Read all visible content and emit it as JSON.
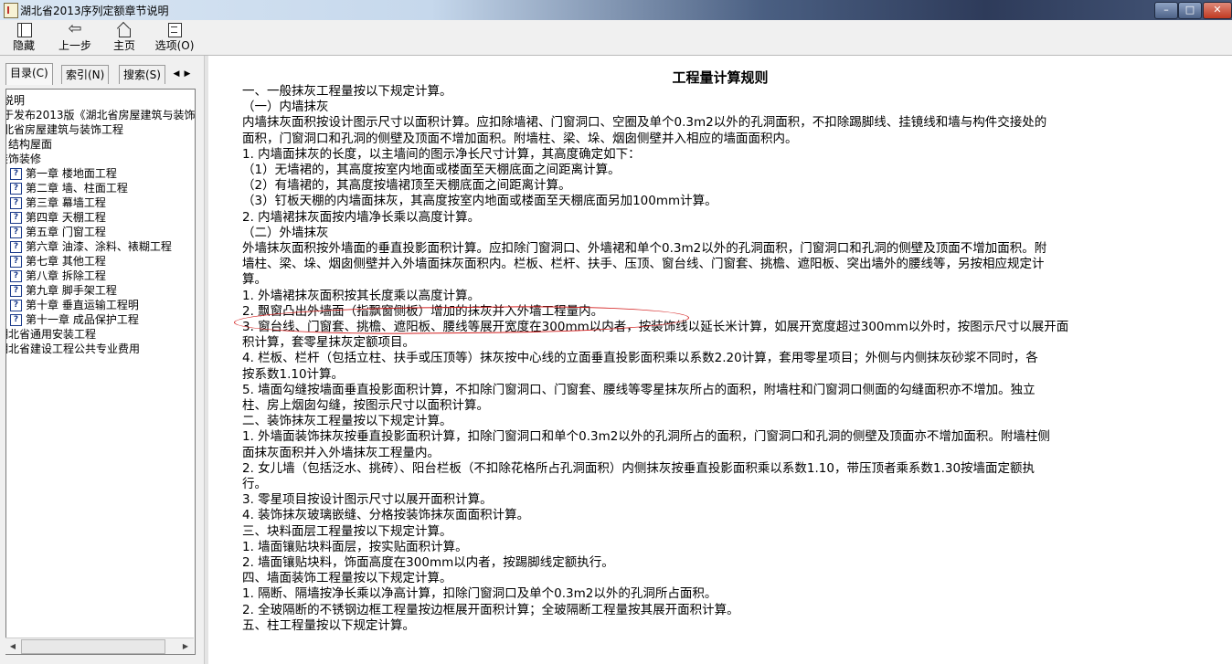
{
  "window": {
    "title": "湖北省2013序列定额章节说明",
    "buttons": {
      "minimize": "–",
      "maximize": "□",
      "close": "✕"
    }
  },
  "toolbar": {
    "hide": "隐藏",
    "back": "上一步",
    "home": "主页",
    "options": "选项(O)"
  },
  "tabs": [
    "目录(C)",
    "索引(N)",
    "搜索(S)"
  ],
  "tree": [
    "说明",
    "关于发布2013版《湖北省房屋建筑与装饰",
    "湖北省房屋建筑与装饰工程",
    "结构屋面",
    "装饰装修",
    "第一章 楼地面工程",
    "第二章 墙、柱面工程",
    "第三章 幕墙工程",
    "第四章 天棚工程",
    "第五章 门窗工程",
    "第六章 油漆、涂料、裱糊工程",
    "第七章 其他工程",
    "第八章 拆除工程",
    "第九章 脚手架工程",
    "第十章 垂直运输工程明",
    "第十一章 成品保护工程",
    "湖北省通用安装工程",
    "湖北省建设工程公共专业费用"
  ],
  "document": {
    "title": "工程量计算规则",
    "lines": [
      "一、一般抹灰工程量按以下规定计算。",
      "（一）内墙抹灰",
      "内墙抹灰面积按设计图示尺寸以面积计算。应扣除墙裙、门窗洞口、空圈及单个0.3m2以外的孔洞面积，不扣除踢脚线、挂镜线和墙与构件交接处的",
      "面积，门窗洞口和孔洞的侧壁及顶面不增加面积。附墙柱、梁、垛、烟囱侧壁并入相应的墙面面积内。",
      "1. 内墙面抹灰的长度，以主墙间的图示净长尺寸计算，其高度确定如下：",
      "（1）无墙裙的，其高度按室内地面或楼面至天棚底面之间距离计算。",
      "（2）有墙裙的，其高度按墙裙顶至天棚底面之间距离计算。",
      "（3）钉板天棚的内墙面抹灰，其高度按室内地面或楼面至天棚底面另加100mm计算。",
      "2. 内墙裙抹灰面按内墙净长乘以高度计算。",
      "（二）外墙抹灰",
      "外墙抹灰面积按外墙面的垂直投影面积计算。应扣除门窗洞口、外墙裙和单个0.3m2以外的孔洞面积，门窗洞口和孔洞的侧壁及顶面不增加面积。附",
      "墙柱、梁、垛、烟囱侧壁并入外墙面抹灰面积内。栏板、栏杆、扶手、压顶、窗台线、门窗套、挑檐、遮阳板、突出墙外的腰线等，另按相应规定计",
      "算。",
      "1. 外墙裙抹灰面积按其长度乘以高度计算。",
      "2. 飘窗凸出外墙面（指飘窗侧板）增加的抹灰并入外墙工程量内。",
      "3. 窗台线、门窗套、挑檐、遮阳板、腰线等展开宽度在300mm以内者，按装饰线以延长米计算，如展开宽度超过300mm以外时，按图示尺寸以展开面",
      "积计算，套零星抹灰定额项目。",
      "4. 栏板、栏杆（包括立柱、扶手或压顶等）抹灰按中心线的立面垂直投影面积乘以系数2.20计算，套用零星项目；外侧与内侧抹灰砂浆不同时，各",
      "按系数1.10计算。",
      "5. 墙面勾缝按墙面垂直投影面积计算，不扣除门窗洞口、门窗套、腰线等零星抹灰所占的面积，附墙柱和门窗洞口侧面的勾缝面积亦不增加。独立",
      "柱、房上烟囱勾缝，按图示尺寸以面积计算。",
      "二、装饰抹灰工程量按以下规定计算。",
      "1. 外墙面装饰抹灰按垂直投影面积计算，扣除门窗洞口和单个0.3m2以外的孔洞所占的面积，门窗洞口和孔洞的侧壁及顶面亦不增加面积。附墙柱侧",
      "面抹灰面积并入外墙抹灰工程量内。",
      "2. 女儿墙（包括泛水、挑砖）、阳台栏板（不扣除花格所占孔洞面积）内侧抹灰按垂直投影面积乘以系数1.10，带压顶者乘系数1.30按墙面定额执",
      "行。",
      "3. 零星项目按设计图示尺寸以展开面积计算。",
      "4. 装饰抹灰玻璃嵌缝、分格按装饰抹灰面面积计算。",
      "三、块料面层工程量按以下规定计算。",
      "1. 墙面镶贴块料面层，按实贴面积计算。",
      "2. 墙面镶贴块料，饰面高度在300mm以内者，按踢脚线定额执行。",
      "四、墙面装饰工程量按以下规定计算。",
      "1. 隔断、隔墙按净长乘以净高计算，扣除门窗洞口及单个0.3m2以外的孔洞所占面积。",
      "2. 全玻隔断的不锈钢边框工程量按边框展开面积计算；全玻隔断工程量按其展开面积计算。",
      "五、柱工程量按以下规定计算。"
    ]
  }
}
